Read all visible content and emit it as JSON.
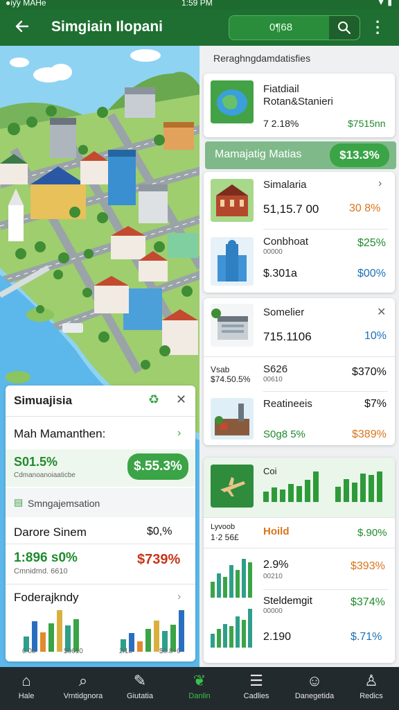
{
  "status_bar": {
    "left": "●iу̂у МАНе",
    "time": "1:59 PM",
    "right": "▼ ▮"
  },
  "app_bar": {
    "title": "Simgiain Ilopani",
    "search_value": "0¶68"
  },
  "right_column": {
    "heading": "Reraghngdamdatisfies",
    "card1": {
      "title_l1": "Fiatdiail",
      "title_l2": "Rotan&Stanieri",
      "meta": "7  2.18%",
      "value": "$7515nn"
    },
    "highlight": {
      "label": "Mamajatig Matias",
      "pill": "$13.3%"
    },
    "card2": {
      "row1": {
        "title": "Simalaria",
        "value": "51,15.7 00",
        "pct": "30 8%"
      },
      "row2": {
        "title": "Conbhoat",
        "sub": "00000",
        "value": "$.301a",
        "pct_top": "$25%",
        "pct_bottom": "$00%"
      }
    },
    "card3": {
      "row1": {
        "title": "Somelier",
        "value": "715.1106",
        "pct": "10%"
      },
      "row2": {
        "left_l1": "Vsab",
        "left_l2": "$74.50.5%",
        "title": "S626",
        "sub": "00610",
        "pct": "$370%"
      },
      "row3": {
        "title": "Reatineeis",
        "value": "S0g8 5%",
        "pct_top": "$7%",
        "pct_bottom": "$389%"
      }
    },
    "card4": {
      "top": {
        "label": "Coi"
      },
      "row1": {
        "left_l1": "Lyvoob",
        "left_l2": "1·2 56£",
        "title": "Hoild",
        "pct": "$.90%"
      },
      "row2": {
        "title": "2.9%",
        "sub": "00210",
        "pct": "$393%"
      },
      "row3": {
        "title": "Steldemgit",
        "sub": "00000",
        "pct": "$374%"
      },
      "row4": {
        "value": "2.190",
        "pct": "$.71%"
      }
    }
  },
  "left_panel": {
    "title": "Simuajisia",
    "section1": "Mah Mamanthen:",
    "stat1": {
      "value": "S01.5%",
      "label": "Cdmanoanoiaaticbe",
      "pill": "$.55.3%"
    },
    "section2": "Smngajemsation",
    "row_a": {
      "title": "Darore Sinem",
      "right": "$0,%"
    },
    "row_b": {
      "value": "1:896 s0%",
      "sub": "Cmnidmd. 6610",
      "right": "$739%"
    },
    "section3": "Foderajkndy",
    "axis": [
      "0.08",
      "$0610",
      "2i13",
      "$0.8+0"
    ],
    "chart_left": [
      14,
      28,
      18,
      26,
      38,
      24,
      30
    ],
    "chart_right": [
      12,
      18,
      10,
      22,
      30,
      20,
      26,
      40
    ]
  },
  "bottom_nav": [
    {
      "icon": "home-icon",
      "label": "Hale"
    },
    {
      "icon": "search-icon",
      "label": "Vrntidgnora"
    },
    {
      "icon": "edit-icon",
      "label": "Giutatia"
    },
    {
      "icon": "leaf-icon",
      "label": "Danlin"
    },
    {
      "icon": "list-icon",
      "label": "Cadlies"
    },
    {
      "icon": "chat-icon",
      "label": "Danegetida"
    },
    {
      "icon": "profile-icon",
      "label": "Redics"
    }
  ],
  "colors": {
    "brand": "#1e6f31",
    "accent": "#3aa446",
    "orange": "#d9741b",
    "blue": "#1b72b7",
    "red": "#c63519"
  },
  "mini_charts": {
    "card4_top_a": [
      10,
      14,
      12,
      18,
      16,
      22,
      30
    ],
    "card4_top_b": [
      16,
      24,
      20,
      30,
      28,
      32
    ],
    "card4_row2": [
      20,
      30,
      26,
      40,
      34,
      48,
      44
    ],
    "card4_row3": [
      18,
      24,
      30,
      28,
      40,
      36,
      50
    ]
  }
}
